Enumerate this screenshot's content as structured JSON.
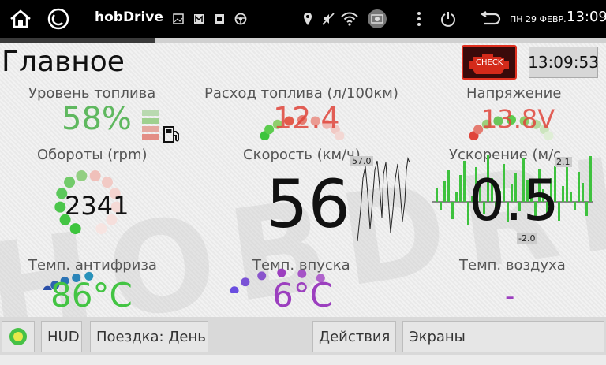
{
  "statusbar": {
    "app_title": "hobDrive",
    "date": "ПН 29 ФЕВР.",
    "time": "13:09"
  },
  "page": {
    "title": "Главное",
    "clock": "13:09:53"
  },
  "check_engine": {
    "label": "CHECK"
  },
  "gauges": {
    "fuel_level": {
      "label": "Уровень топлива",
      "value": "58%",
      "color": "#4caf50",
      "level": 0.58
    },
    "fuel_consumption": {
      "label": "Расход топлива (л/100км)",
      "value": "12.4",
      "color": "#e53935"
    },
    "voltage": {
      "label": "Напряжение",
      "value": "13.8V",
      "color": "#e53935"
    },
    "rpm": {
      "label": "Обороты (rpm)",
      "value": "2341",
      "color": "#111111"
    },
    "speed": {
      "label": "Скорость (км/ч)",
      "value": "56",
      "graph_max": "57.0",
      "color": "#111111"
    },
    "acceleration": {
      "label": "Ускорение (м/с",
      "value": "0.5",
      "graph_max": "2.1",
      "graph_min": "-2.0",
      "color": "#111111"
    },
    "coolant_temp": {
      "label": "Темп. антифриза",
      "value": "86°C",
      "color": "#43c443"
    },
    "intake_temp": {
      "label": "Темп. впуска",
      "value": "6°C",
      "color": "#9c3fbf"
    },
    "air_temp": {
      "label": "Темп. воздуха",
      "value": "-",
      "color": "#9c3fbf"
    }
  },
  "bottombar": {
    "hud": "HUD",
    "trip": "Поездка: День",
    "actions": "Действия",
    "screens": "Экраны"
  }
}
